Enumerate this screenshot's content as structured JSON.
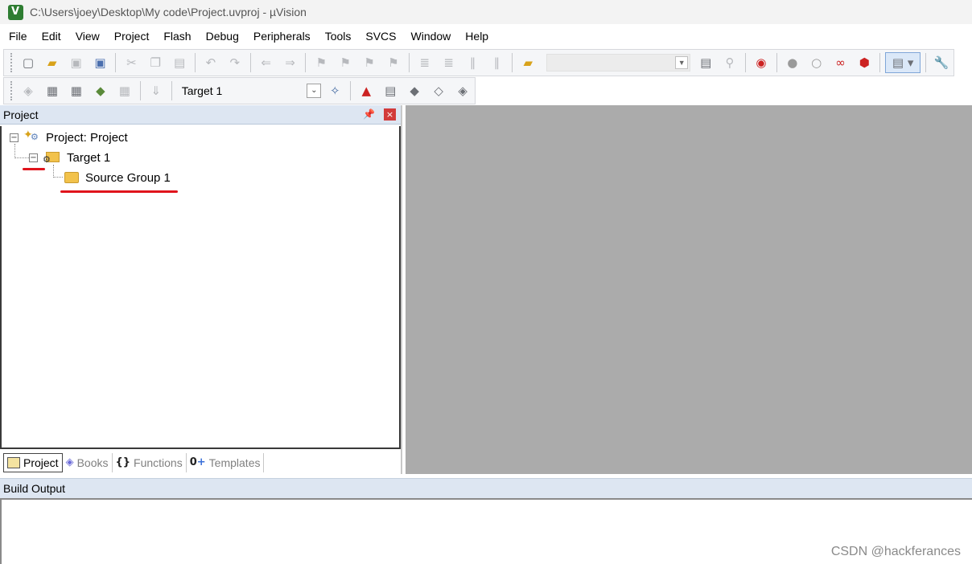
{
  "window": {
    "title": "C:\\Users\\joey\\Desktop\\My code\\Project.uvproj - µVision"
  },
  "menu": [
    "File",
    "Edit",
    "View",
    "Project",
    "Flash",
    "Debug",
    "Peripherals",
    "Tools",
    "SVCS",
    "Window",
    "Help"
  ],
  "toolbar2": {
    "target_select": "Target 1"
  },
  "project_panel": {
    "title": "Project",
    "tree": {
      "root": "Project: Project",
      "target": "Target 1",
      "group": "Source Group 1"
    },
    "tabs": [
      "Project",
      "Books",
      "Functions",
      "Templates"
    ]
  },
  "build_output": {
    "title": "Build Output"
  },
  "watermark": "CSDN @hackferances",
  "colors": {
    "annotation": "#e0141c",
    "editor_bg": "#ababab",
    "panel_header": "#dde6f2"
  }
}
